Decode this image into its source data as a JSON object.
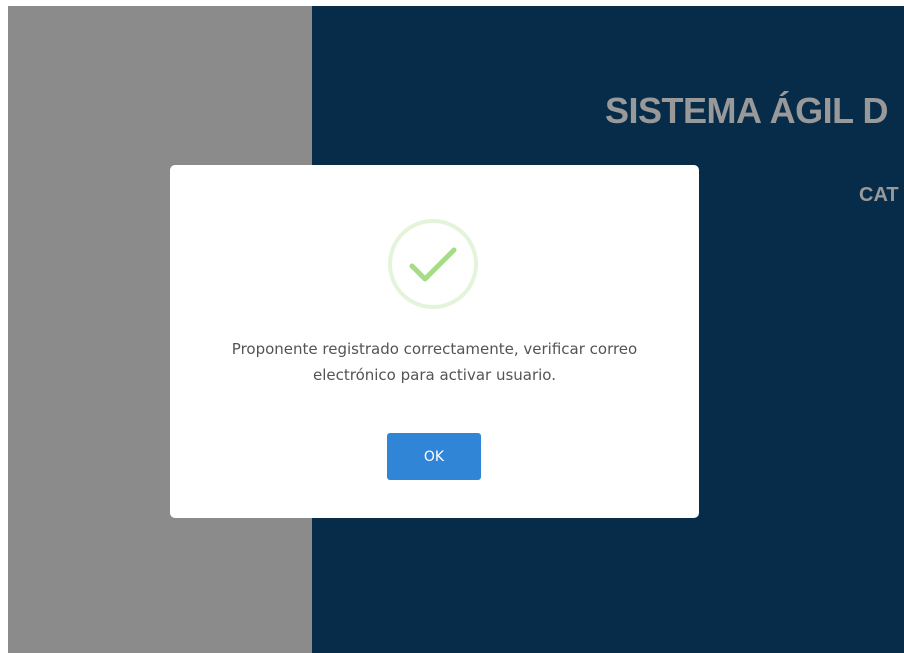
{
  "background": {
    "title": "SISTEMA ÁGIL D",
    "subtitle": "CAT",
    "colors": {
      "left_panel": "#e8e8e8",
      "right_panel": "#0a4a7a"
    }
  },
  "modal": {
    "icon": "success-check-icon",
    "message": "Proponente registrado correctamente, verificar correo electrónico para activar usuario.",
    "confirm_label": "OK",
    "colors": {
      "confirm_button": "#3085d6",
      "success": "#a5dc86"
    }
  }
}
